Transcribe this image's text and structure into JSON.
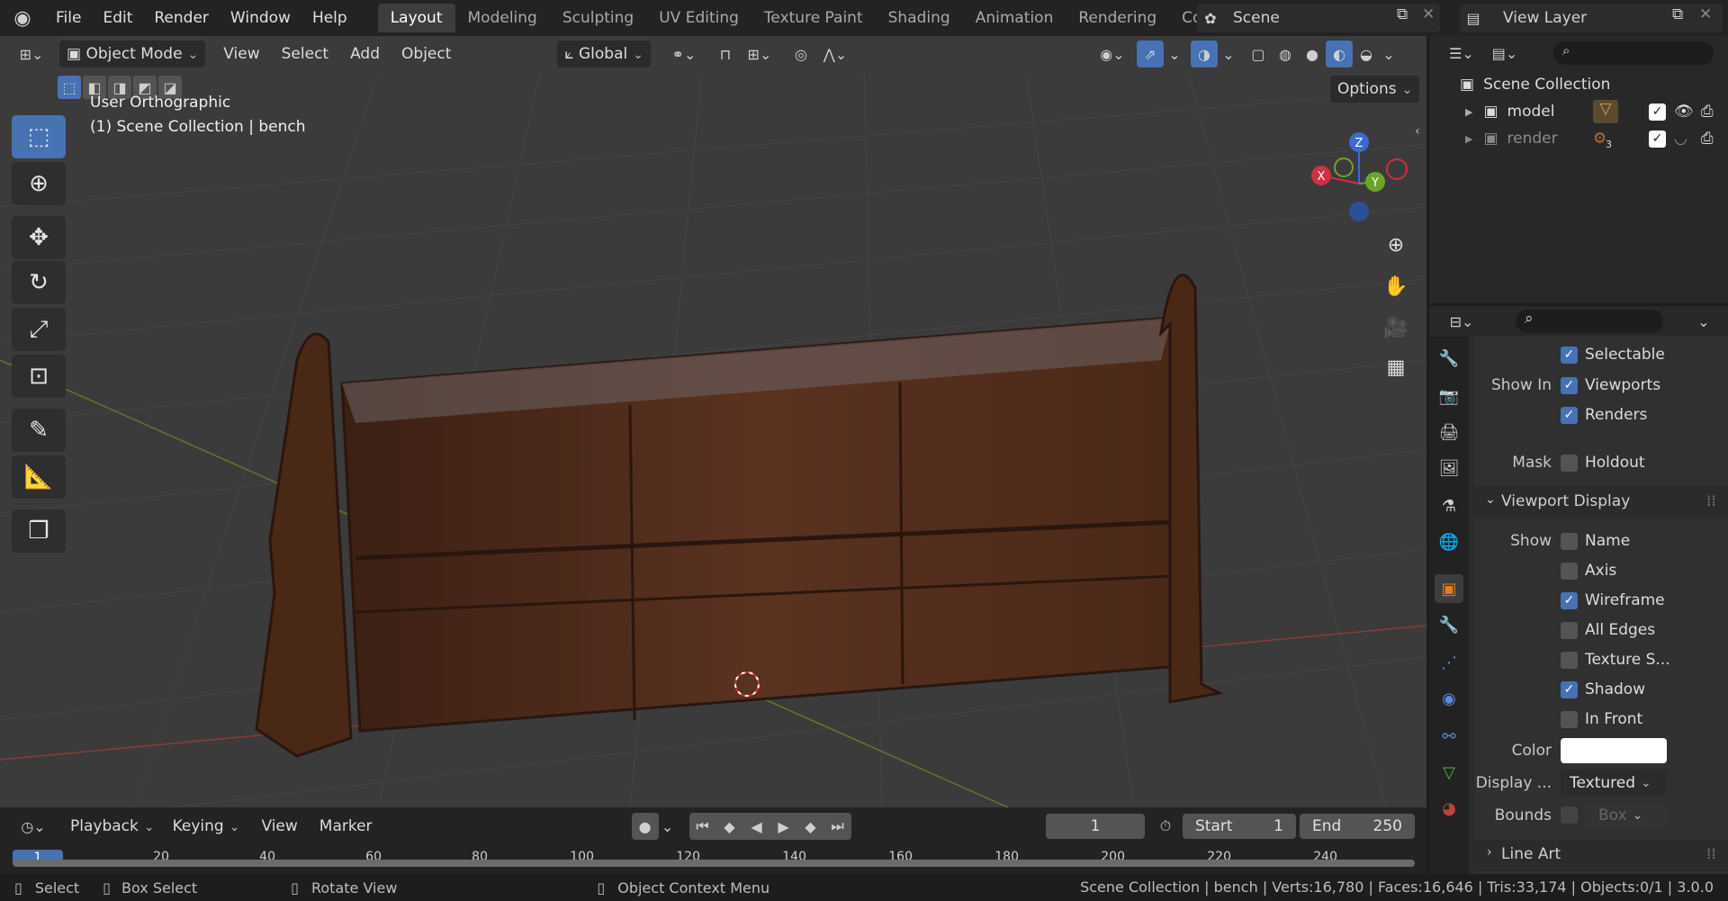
{
  "topbar": {
    "menus": [
      "File",
      "Edit",
      "Render",
      "Window",
      "Help"
    ],
    "workspaces": [
      "Layout",
      "Modeling",
      "Sculpting",
      "UV Editing",
      "Texture Paint",
      "Shading",
      "Animation",
      "Rendering",
      "Compo"
    ],
    "active_workspace": "Layout",
    "scene": "Scene",
    "view_layer": "View Layer"
  },
  "viewport": {
    "mode": "Object Mode",
    "menus": [
      "View",
      "Select",
      "Add",
      "Object"
    ],
    "orientation": "Global",
    "options": "Options",
    "overlay_title": "User Orthographic",
    "overlay_context": "(1) Scene Collection | bench",
    "axes": {
      "x": "X",
      "y": "Y",
      "z": "Z"
    }
  },
  "outliner": {
    "root": "Scene Collection",
    "items": [
      {
        "label": "model",
        "dimmed": false
      },
      {
        "label": "render",
        "dimmed": true,
        "badge": "3"
      }
    ]
  },
  "properties": {
    "selectable": "Selectable",
    "show_in_label": "Show In",
    "viewports": "Viewports",
    "renders": "Renders",
    "mask_label": "Mask",
    "holdout": "Holdout",
    "viewport_display": "Viewport Display",
    "show_label": "Show",
    "show_items": [
      {
        "label": "Name",
        "checked": false
      },
      {
        "label": "Axis",
        "checked": false
      },
      {
        "label": "Wireframe",
        "checked": true
      },
      {
        "label": "All Edges",
        "checked": false
      },
      {
        "label": "Texture S...",
        "checked": false
      },
      {
        "label": "Shadow",
        "checked": true
      },
      {
        "label": "In Front",
        "checked": false
      }
    ],
    "color_label": "Color",
    "display_label": "Display ...",
    "display_value": "Textured",
    "bounds_label": "Bounds",
    "bounds_value": "Box",
    "line_art": "Line Art"
  },
  "timeline": {
    "menus": [
      "Playback",
      "Keying",
      "View",
      "Marker"
    ],
    "current_frame": "1",
    "start_label": "Start",
    "start_value": "1",
    "end_label": "End",
    "end_value": "250",
    "ruler": [
      "1",
      "20",
      "40",
      "60",
      "80",
      "100",
      "120",
      "140",
      "160",
      "180",
      "200",
      "220",
      "240"
    ]
  },
  "status": {
    "select": "Select",
    "box_select": "Box Select",
    "rotate_view": "Rotate View",
    "context_menu": "Object Context Menu",
    "stats": "Scene Collection | bench | Verts:16,780 | Faces:16,646 | Tris:33,174 | Objects:0/1 | 3.0.0"
  },
  "colors": {
    "accent": "#4772b3",
    "viewport_bg": "#3b3b3b",
    "wood": "#5a3220"
  }
}
